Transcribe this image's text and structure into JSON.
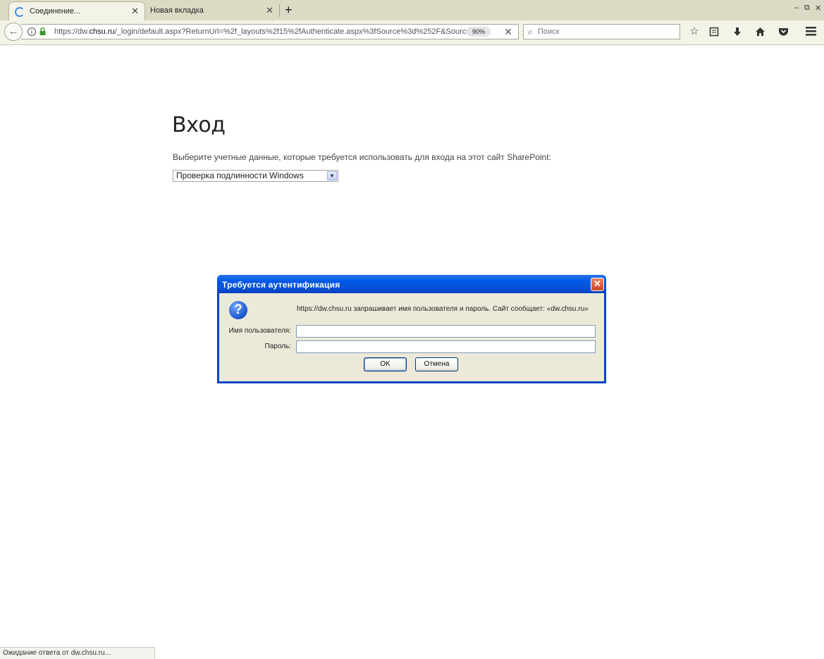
{
  "browser": {
    "tabs": [
      {
        "title": "Соединение...",
        "loading": true,
        "active": true
      },
      {
        "title": "Новая вкладка",
        "loading": false,
        "active": false
      }
    ],
    "tab_close_glyph": "✕",
    "new_tab_glyph": "+",
    "window_controls": {
      "minimize": "–",
      "restore": "⧉",
      "close": "✕"
    },
    "url": {
      "prefix": "https://dw.",
      "domain": "chsu.ru",
      "suffix": "/_login/default.aspx?ReturnUrl=%2f_layouts%2f15%2fAuthenticate.aspx%3fSource%3d%252F&Source=%",
      "zoom": "90%",
      "clear_glyph": "✕"
    },
    "search": {
      "placeholder": "Поиск"
    }
  },
  "page": {
    "title": "Вход",
    "description": "Выберите учетные данные, которые требуется использовать для входа на этот сайт SharePoint:",
    "provider_select": {
      "selected": "Проверка подлинности Windows"
    }
  },
  "dialog": {
    "title": "Требуется аутентификация",
    "message": "https://dw.chsu.ru запрашивает имя пользователя и пароль. Сайт сообщает: «dw.chsu.ru»",
    "username_label": "Имя пользователя:",
    "password_label": "Пароль:",
    "username_value": "",
    "password_value": "",
    "ok_label": "OK",
    "cancel_label": "Отмена",
    "icon": "question-icon"
  },
  "status": {
    "text": "Ожидание ответа от dw.chsu.ru..."
  },
  "colors": {
    "tabstrip_bg": "#dcdac5",
    "toolbar_bg": "#f4f3e8",
    "dialog_title_blue": "#0058e6",
    "dialog_body": "#ece9d8",
    "close_red": "#c94525"
  }
}
